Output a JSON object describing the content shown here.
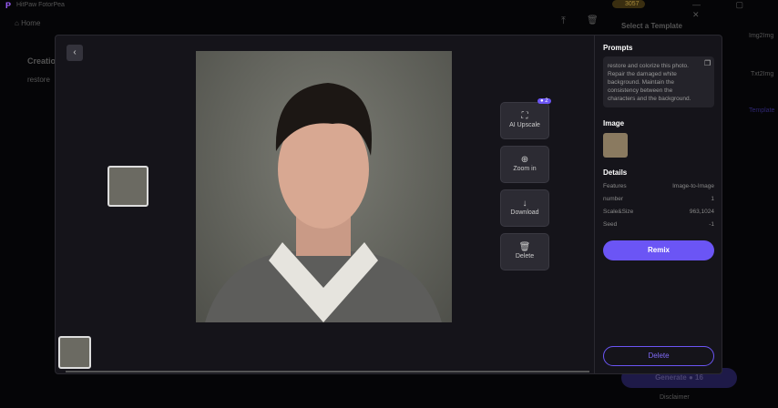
{
  "app": {
    "title": "HitPaw FotorPea",
    "credits": "3057",
    "home": "Home",
    "select_template": "Select a Template",
    "creation": "Creatio",
    "restore_peek": "restore"
  },
  "right_nav": [
    {
      "label": "Img2Img"
    },
    {
      "label": "Txt2Img"
    },
    {
      "label": "Template"
    }
  ],
  "tools": [
    {
      "label": "AI Upscale",
      "icon": "upscale-icon",
      "badge": "2"
    },
    {
      "label": "Zoom in",
      "icon": "zoom-in-icon"
    },
    {
      "label": "Download",
      "icon": "download-icon"
    },
    {
      "label": "Delete",
      "icon": "trash-icon"
    }
  ],
  "panel": {
    "prompts_title": "Prompts",
    "prompt": "restore and colorize this photo. Repair the damaged white background. Maintain the consistency between the characters and the background.",
    "image_title": "Image",
    "details_title": "Details",
    "details": [
      {
        "k": "Features",
        "v": "Image-to-Image"
      },
      {
        "k": "number",
        "v": "1"
      },
      {
        "k": "Scale&Size",
        "v": "963,1024"
      },
      {
        "k": "Seed",
        "v": "-1"
      }
    ],
    "remix": "Remix",
    "delete": "Delete"
  },
  "footer": {
    "generate": "Generate",
    "cost": "16",
    "disclaimer": "Disclaimer"
  },
  "colors": {
    "accent": "#6b55f5",
    "bg": "#15141a"
  }
}
